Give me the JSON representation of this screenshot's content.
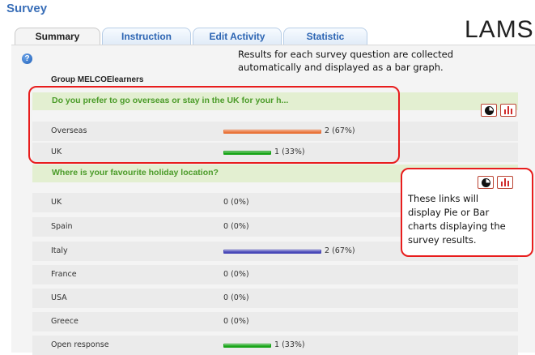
{
  "app": {
    "title": "Survey",
    "logo_text": "LAMS"
  },
  "tabs": [
    {
      "label": "Summary",
      "active": true
    },
    {
      "label": "Instruction",
      "active": false
    },
    {
      "label": "Edit Activity",
      "active": false
    },
    {
      "label": "Statistic",
      "active": false
    }
  ],
  "help_icon": {
    "name": "help-icon",
    "glyph": "?"
  },
  "annotations": {
    "top_line1": "Results for each survey question are collected",
    "top_line2": "automatically and displayed as a bar graph.",
    "side_line1": "These links will",
    "side_line2": "display Pie or Bar",
    "side_line3": "charts displaying the",
    "side_line4": "survey results."
  },
  "group": {
    "label": "Group MELCOElearners"
  },
  "chart_buttons": {
    "pie_icon": "pie-chart-icon",
    "bar_icon": "bar-chart-icon"
  },
  "questions": [
    {
      "text": "Do you prefer to go overseas or stay in the UK for your h...",
      "answers": [
        {
          "label": "Overseas",
          "value": "2 (67%)",
          "fraction": 0.67,
          "color": "#e9743a"
        },
        {
          "label": "UK",
          "value": "1 (33%)",
          "fraction": 0.33,
          "color": "#1aa51a"
        }
      ]
    },
    {
      "text": "Where is your favourite holiday location?",
      "answers": [
        {
          "label": "UK",
          "value": "0 (0%)",
          "fraction": 0,
          "color": "#1aa51a"
        },
        {
          "label": "Spain",
          "value": "0 (0%)",
          "fraction": 0,
          "color": "#1aa51a"
        },
        {
          "label": "Italy",
          "value": "2 (67%)",
          "fraction": 0.67,
          "color": "#4848b8"
        },
        {
          "label": "France",
          "value": "0 (0%)",
          "fraction": 0,
          "color": "#1aa51a"
        },
        {
          "label": "USA",
          "value": "0 (0%)",
          "fraction": 0,
          "color": "#1aa51a"
        },
        {
          "label": "Greece",
          "value": "0 (0%)",
          "fraction": 0,
          "color": "#1aa51a"
        },
        {
          "label": "Open response",
          "value": "1 (33%)",
          "fraction": 0.33,
          "color": "#1aa51a"
        }
      ]
    }
  ],
  "colors": {
    "accent": "#3a6fb8",
    "question_green": "#4a9b28",
    "highlight_red": "#e81d1d"
  }
}
